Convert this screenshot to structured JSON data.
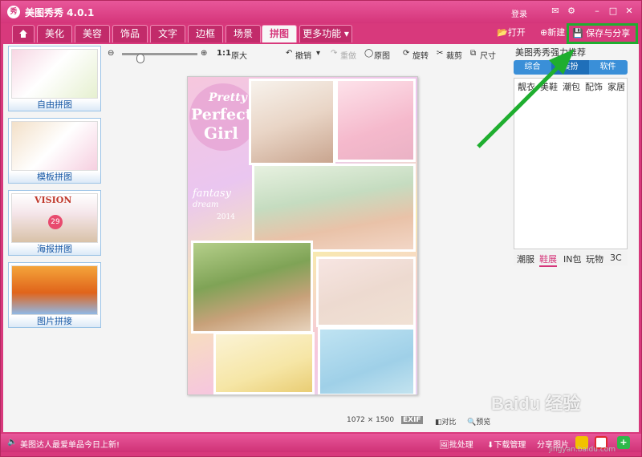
{
  "titlebar": {
    "logo_text": "秀",
    "app_title": "美图秀秀 4.0.1",
    "login": "登录"
  },
  "menu": {
    "tabs": [
      "美化",
      "美容",
      "饰品",
      "文字",
      "边框",
      "场景",
      "拼图",
      "更多功能"
    ],
    "active": "拼图",
    "open_label": "打开",
    "new_label": "新建",
    "save_share_label": "保存与分享"
  },
  "left_tools": [
    {
      "label": "自由拼图"
    },
    {
      "label": "模板拼图"
    },
    {
      "label": "海报拼图"
    },
    {
      "label": "图片拼接"
    }
  ],
  "toolbar": {
    "ratio": "1:1",
    "original_size": "原大",
    "undo": "撤销",
    "redo": "重做",
    "original": "原图",
    "rotate": "旋转",
    "crop": "裁剪",
    "size": "尺寸"
  },
  "canvas": {
    "deco_1": "Pretty",
    "deco_2": "Perfect",
    "deco_3": "Girl",
    "deco_4": "fantasy",
    "deco_5": "dream",
    "deco_6": "2014",
    "thumb_text": "VISION",
    "thumb_num": "29"
  },
  "canvas_info": {
    "dims": "1072 × 1500",
    "exif": "EXIF",
    "compare": "对比",
    "preview": "预览"
  },
  "right_panel": {
    "title": "美图秀秀强力推荐",
    "tabs": [
      "综合",
      "装扮",
      "软件"
    ],
    "categories": [
      "靓衣",
      "美鞋",
      "潮包",
      "配饰",
      "家居"
    ],
    "bottom_tabs": [
      "潮服",
      "鞋展",
      "IN包",
      "玩物",
      "3C"
    ],
    "active_bottom": "鞋展"
  },
  "statusbar": {
    "message": "美图达人最爱单品今日上新!",
    "batch": "批处理",
    "download": "下载管理",
    "share": "分享图片"
  },
  "watermark": {
    "brand": "Baidu 经验",
    "url": "jingyan.baidu.com"
  },
  "colors": {
    "accent": "#d5357a",
    "highlight": "#1fae2f",
    "blue": "#3a8fd8"
  }
}
